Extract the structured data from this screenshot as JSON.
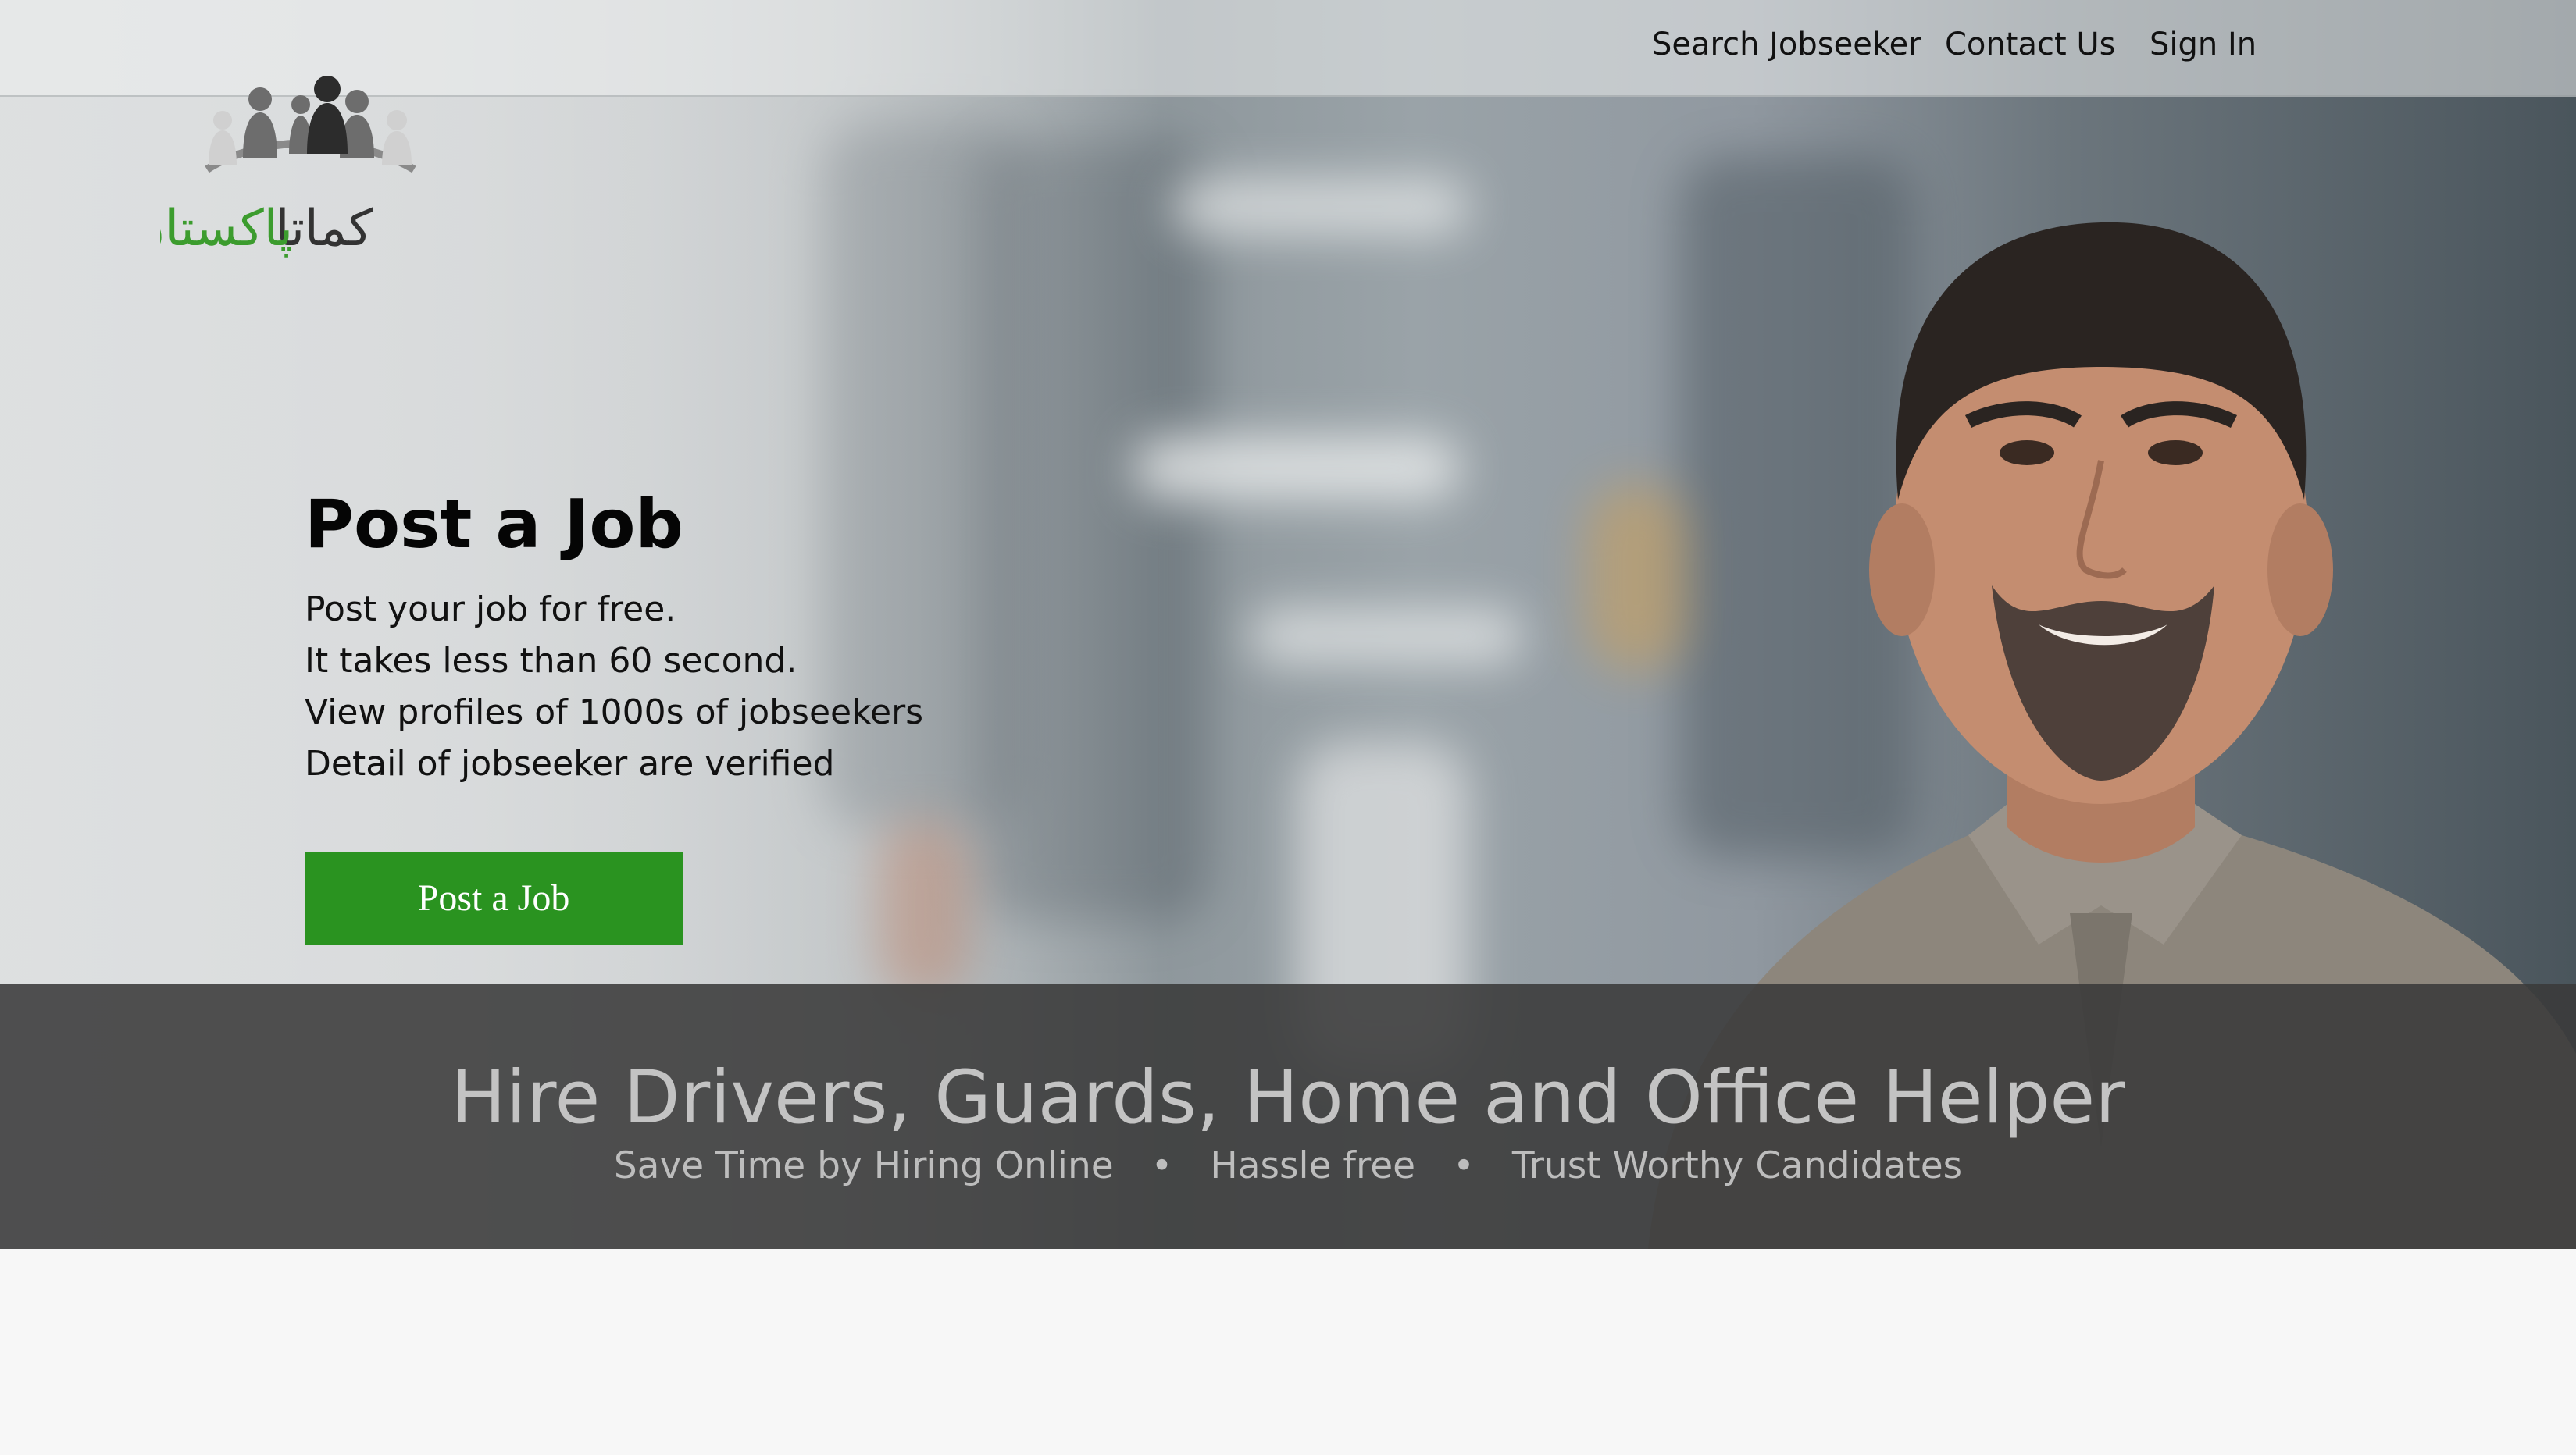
{
  "nav": {
    "links": [
      "Search Jobseeker",
      "Contact Us",
      "Sign In"
    ]
  },
  "logo": {
    "text_green": "پاکستان",
    "text_dark": "کماتا"
  },
  "hero": {
    "title": "Post a Job",
    "lines": [
      "Post your job for free.",
      "It takes less than 60 second.",
      "View profiles of 1000s of jobseekers",
      "Detail of jobseeker are verified"
    ],
    "cta_label": "Post a Job"
  },
  "band": {
    "title": "Hire Drivers, Guards, Home and Office Helper",
    "features": [
      "Save Time by Hiring Online",
      "Hassle free",
      "Trust Worthy Candidates"
    ],
    "separator": "•"
  },
  "colors": {
    "brand_green": "#2a9320",
    "band_bg": "#3a3a3a"
  }
}
